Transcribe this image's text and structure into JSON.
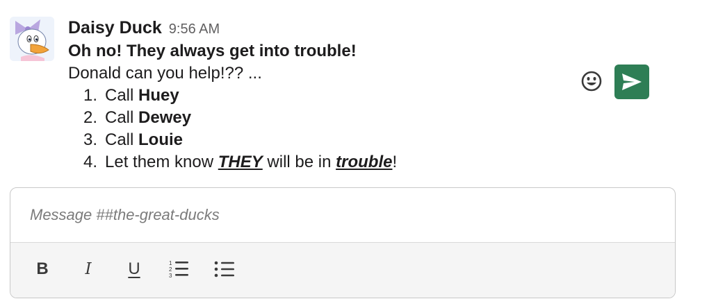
{
  "message": {
    "author": "Daisy Duck",
    "time": "9:56 AM",
    "headline": "Oh no! They always get into trouble!",
    "intro": "Donald can you help!?? ...",
    "steps": [
      {
        "number": "1.",
        "prefix": "Call ",
        "emphasis": "Huey"
      },
      {
        "number": "2.",
        "prefix": "Call ",
        "emphasis": "Dewey"
      },
      {
        "number": "3.",
        "prefix": "Call ",
        "emphasis": "Louie"
      },
      {
        "number": "4.",
        "prefix": "Let them know ",
        "emphasis1": "THEY",
        "middle": " will be in ",
        "emphasis2": "trouble",
        "suffix": "!"
      }
    ]
  },
  "composer": {
    "placeholder": "Message ##the-great-ducks",
    "value": "",
    "toolbar": {
      "bold_label": "B",
      "italic_label": "I",
      "underline_label": "U"
    }
  },
  "icons": {
    "bold": "bold-icon",
    "italic": "italic-icon",
    "underline": "underline-icon",
    "ordered_list": "ordered-list-icon",
    "bullet_list": "bullet-list-icon",
    "emoji": "smiley-icon",
    "send": "send-icon"
  },
  "colors": {
    "send_button": "#2e7e55",
    "text": "#1d1c1d",
    "timestamp": "#616061",
    "placeholder": "#7b7b7b",
    "toolbar_bg": "#f5f5f5"
  }
}
